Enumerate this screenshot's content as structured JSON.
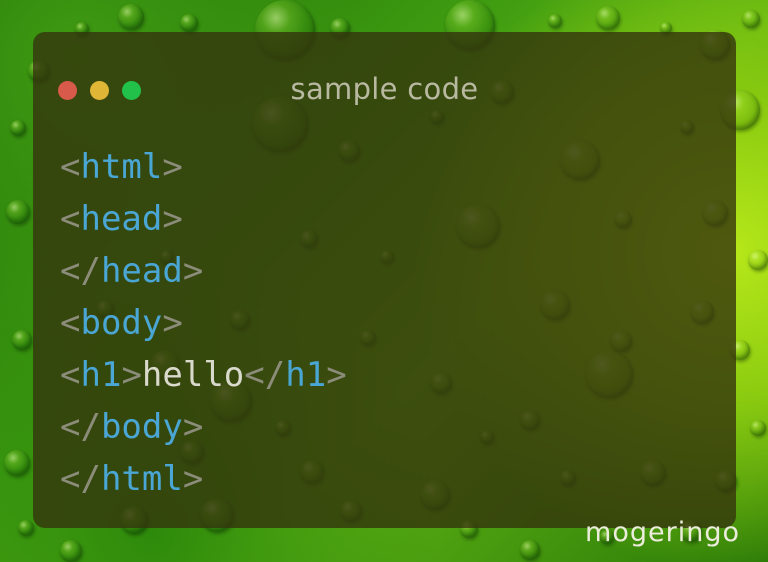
{
  "window": {
    "title": "sample code",
    "controls": [
      {
        "name": "close",
        "color": "#d85a4a"
      },
      {
        "name": "minimize",
        "color": "#e0b636"
      },
      {
        "name": "maximize",
        "color": "#22c24a"
      }
    ]
  },
  "code_lines": [
    [
      {
        "t": "<",
        "c": "punct"
      },
      {
        "t": "html",
        "c": "tag"
      },
      {
        "t": ">",
        "c": "punct"
      }
    ],
    [
      {
        "t": "<",
        "c": "punct"
      },
      {
        "t": "head",
        "c": "tag"
      },
      {
        "t": ">",
        "c": "punct"
      }
    ],
    [
      {
        "t": "</",
        "c": "punct"
      },
      {
        "t": "head",
        "c": "tag"
      },
      {
        "t": ">",
        "c": "punct"
      }
    ],
    [
      {
        "t": "<",
        "c": "punct"
      },
      {
        "t": "body",
        "c": "tag"
      },
      {
        "t": ">",
        "c": "punct"
      }
    ],
    [
      {
        "t": "<",
        "c": "punct"
      },
      {
        "t": "h1",
        "c": "tag"
      },
      {
        "t": ">",
        "c": "punct"
      },
      {
        "t": "hello",
        "c": "txt"
      },
      {
        "t": "</",
        "c": "punct"
      },
      {
        "t": "h1",
        "c": "tag"
      },
      {
        "t": ">",
        "c": "punct"
      }
    ],
    [
      {
        "t": "</",
        "c": "punct"
      },
      {
        "t": "body",
        "c": "tag"
      },
      {
        "t": ">",
        "c": "punct"
      }
    ],
    [
      {
        "t": "</",
        "c": "punct"
      },
      {
        "t": "html",
        "c": "tag"
      },
      {
        "t": ">",
        "c": "punct"
      }
    ]
  ],
  "colors": {
    "tag": "#4aa6d4",
    "punctuation": "#8c8c7a",
    "text": "#d9d9cc",
    "window_bg": "rgba(52,52,12,0.80)"
  },
  "watermark": "mogeringo"
}
